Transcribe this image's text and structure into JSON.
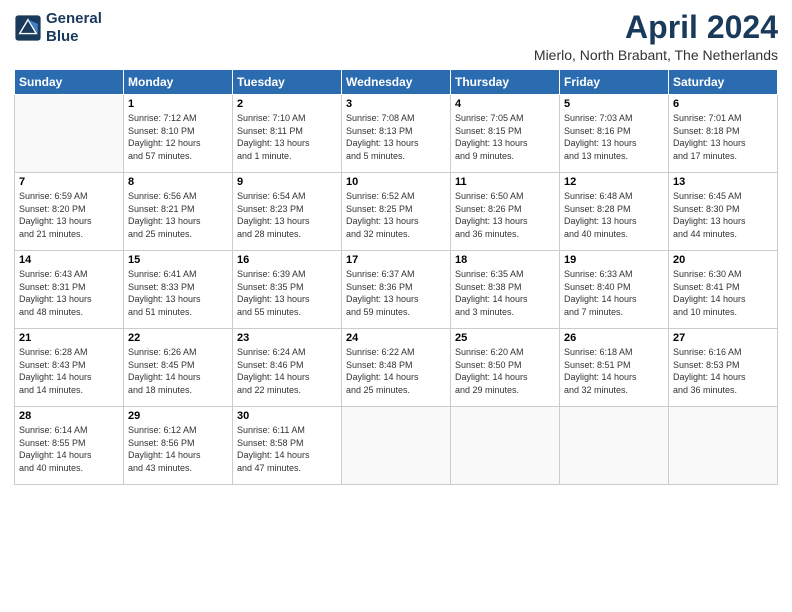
{
  "logo": {
    "line1": "General",
    "line2": "Blue"
  },
  "title": "April 2024",
  "location": "Mierlo, North Brabant, The Netherlands",
  "days_header": [
    "Sunday",
    "Monday",
    "Tuesday",
    "Wednesday",
    "Thursday",
    "Friday",
    "Saturday"
  ],
  "weeks": [
    [
      {
        "day": "",
        "info": ""
      },
      {
        "day": "1",
        "info": "Sunrise: 7:12 AM\nSunset: 8:10 PM\nDaylight: 12 hours\nand 57 minutes."
      },
      {
        "day": "2",
        "info": "Sunrise: 7:10 AM\nSunset: 8:11 PM\nDaylight: 13 hours\nand 1 minute."
      },
      {
        "day": "3",
        "info": "Sunrise: 7:08 AM\nSunset: 8:13 PM\nDaylight: 13 hours\nand 5 minutes."
      },
      {
        "day": "4",
        "info": "Sunrise: 7:05 AM\nSunset: 8:15 PM\nDaylight: 13 hours\nand 9 minutes."
      },
      {
        "day": "5",
        "info": "Sunrise: 7:03 AM\nSunset: 8:16 PM\nDaylight: 13 hours\nand 13 minutes."
      },
      {
        "day": "6",
        "info": "Sunrise: 7:01 AM\nSunset: 8:18 PM\nDaylight: 13 hours\nand 17 minutes."
      }
    ],
    [
      {
        "day": "7",
        "info": "Sunrise: 6:59 AM\nSunset: 8:20 PM\nDaylight: 13 hours\nand 21 minutes."
      },
      {
        "day": "8",
        "info": "Sunrise: 6:56 AM\nSunset: 8:21 PM\nDaylight: 13 hours\nand 25 minutes."
      },
      {
        "day": "9",
        "info": "Sunrise: 6:54 AM\nSunset: 8:23 PM\nDaylight: 13 hours\nand 28 minutes."
      },
      {
        "day": "10",
        "info": "Sunrise: 6:52 AM\nSunset: 8:25 PM\nDaylight: 13 hours\nand 32 minutes."
      },
      {
        "day": "11",
        "info": "Sunrise: 6:50 AM\nSunset: 8:26 PM\nDaylight: 13 hours\nand 36 minutes."
      },
      {
        "day": "12",
        "info": "Sunrise: 6:48 AM\nSunset: 8:28 PM\nDaylight: 13 hours\nand 40 minutes."
      },
      {
        "day": "13",
        "info": "Sunrise: 6:45 AM\nSunset: 8:30 PM\nDaylight: 13 hours\nand 44 minutes."
      }
    ],
    [
      {
        "day": "14",
        "info": "Sunrise: 6:43 AM\nSunset: 8:31 PM\nDaylight: 13 hours\nand 48 minutes."
      },
      {
        "day": "15",
        "info": "Sunrise: 6:41 AM\nSunset: 8:33 PM\nDaylight: 13 hours\nand 51 minutes."
      },
      {
        "day": "16",
        "info": "Sunrise: 6:39 AM\nSunset: 8:35 PM\nDaylight: 13 hours\nand 55 minutes."
      },
      {
        "day": "17",
        "info": "Sunrise: 6:37 AM\nSunset: 8:36 PM\nDaylight: 13 hours\nand 59 minutes."
      },
      {
        "day": "18",
        "info": "Sunrise: 6:35 AM\nSunset: 8:38 PM\nDaylight: 14 hours\nand 3 minutes."
      },
      {
        "day": "19",
        "info": "Sunrise: 6:33 AM\nSunset: 8:40 PM\nDaylight: 14 hours\nand 7 minutes."
      },
      {
        "day": "20",
        "info": "Sunrise: 6:30 AM\nSunset: 8:41 PM\nDaylight: 14 hours\nand 10 minutes."
      }
    ],
    [
      {
        "day": "21",
        "info": "Sunrise: 6:28 AM\nSunset: 8:43 PM\nDaylight: 14 hours\nand 14 minutes."
      },
      {
        "day": "22",
        "info": "Sunrise: 6:26 AM\nSunset: 8:45 PM\nDaylight: 14 hours\nand 18 minutes."
      },
      {
        "day": "23",
        "info": "Sunrise: 6:24 AM\nSunset: 8:46 PM\nDaylight: 14 hours\nand 22 minutes."
      },
      {
        "day": "24",
        "info": "Sunrise: 6:22 AM\nSunset: 8:48 PM\nDaylight: 14 hours\nand 25 minutes."
      },
      {
        "day": "25",
        "info": "Sunrise: 6:20 AM\nSunset: 8:50 PM\nDaylight: 14 hours\nand 29 minutes."
      },
      {
        "day": "26",
        "info": "Sunrise: 6:18 AM\nSunset: 8:51 PM\nDaylight: 14 hours\nand 32 minutes."
      },
      {
        "day": "27",
        "info": "Sunrise: 6:16 AM\nSunset: 8:53 PM\nDaylight: 14 hours\nand 36 minutes."
      }
    ],
    [
      {
        "day": "28",
        "info": "Sunrise: 6:14 AM\nSunset: 8:55 PM\nDaylight: 14 hours\nand 40 minutes."
      },
      {
        "day": "29",
        "info": "Sunrise: 6:12 AM\nSunset: 8:56 PM\nDaylight: 14 hours\nand 43 minutes."
      },
      {
        "day": "30",
        "info": "Sunrise: 6:11 AM\nSunset: 8:58 PM\nDaylight: 14 hours\nand 47 minutes."
      },
      {
        "day": "",
        "info": ""
      },
      {
        "day": "",
        "info": ""
      },
      {
        "day": "",
        "info": ""
      },
      {
        "day": "",
        "info": ""
      }
    ]
  ]
}
